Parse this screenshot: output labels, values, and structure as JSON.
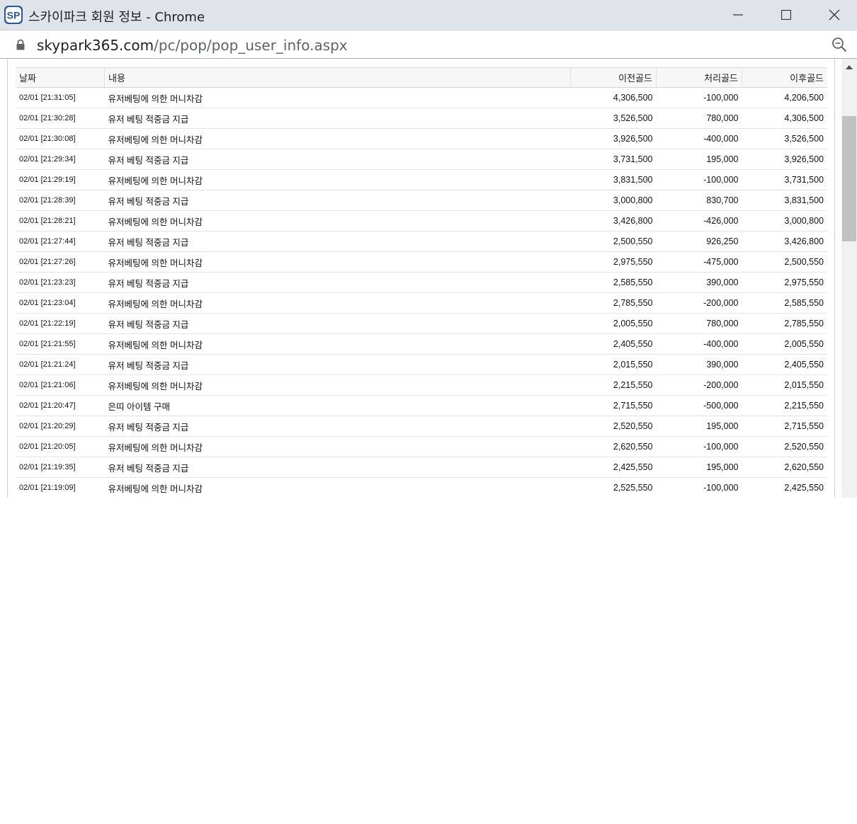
{
  "window": {
    "title": "스카이파크 회원 정보 - Chrome",
    "logo_text": "SP"
  },
  "address": {
    "host": "skypark365.com",
    "path": "/pc/pop/pop_user_info.aspx"
  },
  "colors": {
    "title_bg": "#dfe3ea",
    "logo": "#2b5797"
  },
  "icons": {
    "lock": "lock-icon",
    "zoom": "zoom-icon",
    "minimize": "minimize-icon",
    "maximize": "maximize-icon",
    "close": "close-icon"
  },
  "table": {
    "headers": {
      "date": "날짜",
      "desc": "내용",
      "before": "이전골드",
      "change": "처리골드",
      "after": "이후골드"
    },
    "rows": [
      {
        "date": "02/01 [21:31:05]",
        "desc": "유저베팅에 의한 머니차감",
        "before": "4,306,500",
        "change": "-100,000",
        "after": "4,206,500"
      },
      {
        "date": "02/01 [21:30:28]",
        "desc": "유저 베팅 적중금 지급",
        "before": "3,526,500",
        "change": "780,000",
        "after": "4,306,500"
      },
      {
        "date": "02/01 [21:30:08]",
        "desc": "유저베팅에 의한 머니차감",
        "before": "3,926,500",
        "change": "-400,000",
        "after": "3,526,500"
      },
      {
        "date": "02/01 [21:29:34]",
        "desc": "유저 베팅 적중금 지급",
        "before": "3,731,500",
        "change": "195,000",
        "after": "3,926,500"
      },
      {
        "date": "02/01 [21:29:19]",
        "desc": "유저베팅에 의한 머니차감",
        "before": "3,831,500",
        "change": "-100,000",
        "after": "3,731,500"
      },
      {
        "date": "02/01 [21:28:39]",
        "desc": "유저 베팅 적중금 지급",
        "before": "3,000,800",
        "change": "830,700",
        "after": "3,831,500"
      },
      {
        "date": "02/01 [21:28:21]",
        "desc": "유저베팅에 의한 머니차감",
        "before": "3,426,800",
        "change": "-426,000",
        "after": "3,000,800"
      },
      {
        "date": "02/01 [21:27:44]",
        "desc": "유저 베팅 적중금 지급",
        "before": "2,500,550",
        "change": "926,250",
        "after": "3,426,800"
      },
      {
        "date": "02/01 [21:27:26]",
        "desc": "유저베팅에 의한 머니차감",
        "before": "2,975,550",
        "change": "-475,000",
        "after": "2,500,550"
      },
      {
        "date": "02/01 [21:23:23]",
        "desc": "유저 베팅 적중금 지급",
        "before": "2,585,550",
        "change": "390,000",
        "after": "2,975,550"
      },
      {
        "date": "02/01 [21:23:04]",
        "desc": "유저베팅에 의한 머니차감",
        "before": "2,785,550",
        "change": "-200,000",
        "after": "2,585,550"
      },
      {
        "date": "02/01 [21:22:19]",
        "desc": "유저 베팅 적중금 지급",
        "before": "2,005,550",
        "change": "780,000",
        "after": "2,785,550"
      },
      {
        "date": "02/01 [21:21:55]",
        "desc": "유저베팅에 의한 머니차감",
        "before": "2,405,550",
        "change": "-400,000",
        "after": "2,005,550"
      },
      {
        "date": "02/01 [21:21:24]",
        "desc": "유저 베팅 적중금 지급",
        "before": "2,015,550",
        "change": "390,000",
        "after": "2,405,550"
      },
      {
        "date": "02/01 [21:21:06]",
        "desc": "유저베팅에 의한 머니차감",
        "before": "2,215,550",
        "change": "-200,000",
        "after": "2,015,550"
      },
      {
        "date": "02/01 [21:20:47]",
        "desc": "은띠 아이템 구매",
        "before": "2,715,550",
        "change": "-500,000",
        "after": "2,215,550"
      },
      {
        "date": "02/01 [21:20:29]",
        "desc": "유저 베팅 적중금 지급",
        "before": "2,520,550",
        "change": "195,000",
        "after": "2,715,550"
      },
      {
        "date": "02/01 [21:20:05]",
        "desc": "유저베팅에 의한 머니차감",
        "before": "2,620,550",
        "change": "-100,000",
        "after": "2,520,550"
      },
      {
        "date": "02/01 [21:19:35]",
        "desc": "유저 베팅 적중금 지급",
        "before": "2,425,550",
        "change": "195,000",
        "after": "2,620,550"
      },
      {
        "date": "02/01 [21:19:09]",
        "desc": "유저베팅에 의한 머니차감",
        "before": "2,525,550",
        "change": "-100,000",
        "after": "2,425,550"
      }
    ]
  }
}
